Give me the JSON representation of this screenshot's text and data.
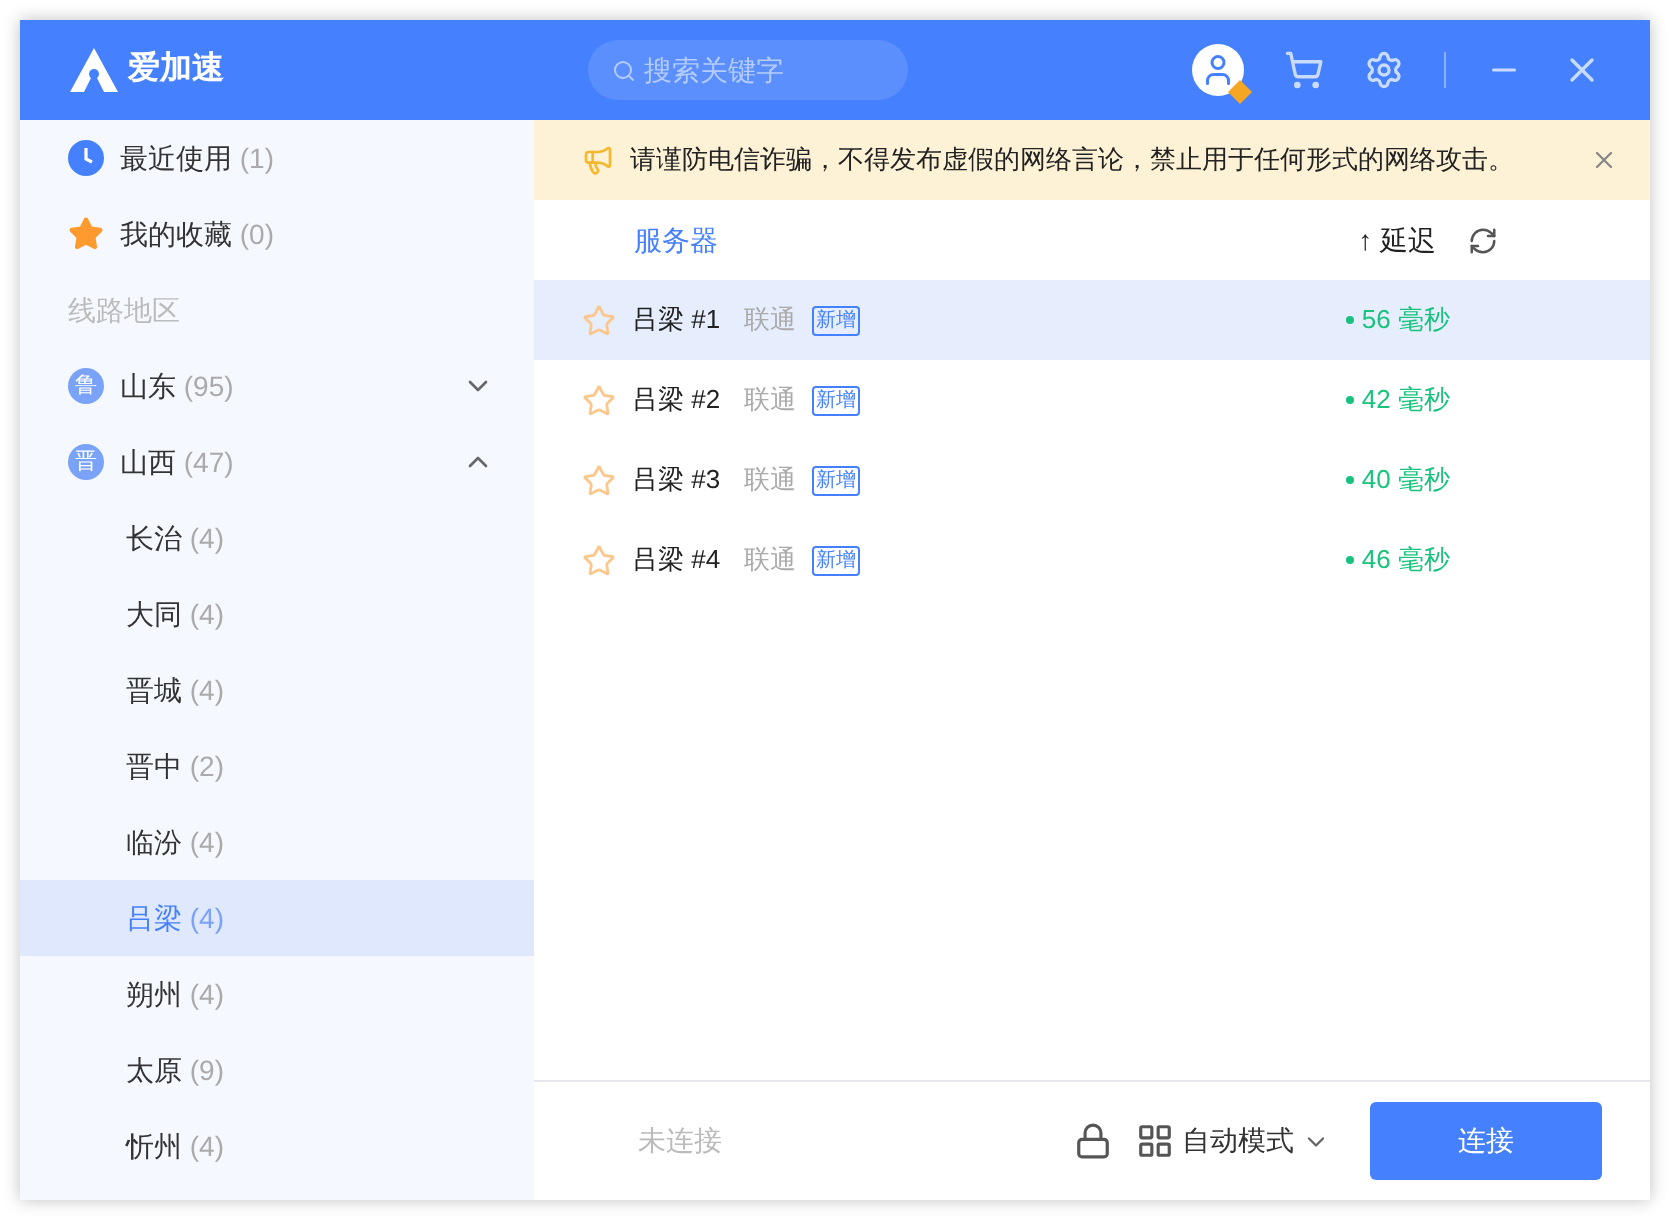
{
  "header": {
    "logo_text": "爱加速",
    "search": {
      "placeholder": "搜索关键字"
    }
  },
  "sidebar": {
    "quick": [
      {
        "kind": "recent",
        "label": "最近使用",
        "count": "(1)"
      },
      {
        "kind": "favorites",
        "label": "我的收藏",
        "count": "(0)"
      }
    ],
    "section_label": "线路地区",
    "regions": [
      {
        "badge": "鲁",
        "name": "山东",
        "count": "(95)",
        "expanded": false
      },
      {
        "badge": "晋",
        "name": "山西",
        "count": "(47)",
        "expanded": true,
        "children": [
          {
            "name": "长治",
            "count": "(4)",
            "selected": false
          },
          {
            "name": "大同",
            "count": "(4)",
            "selected": false
          },
          {
            "name": "晋城",
            "count": "(4)",
            "selected": false
          },
          {
            "name": "晋中",
            "count": "(2)",
            "selected": false
          },
          {
            "name": "临汾",
            "count": "(4)",
            "selected": false
          },
          {
            "name": "吕梁",
            "count": "(4)",
            "selected": true
          },
          {
            "name": "朔州",
            "count": "(4)",
            "selected": false
          },
          {
            "name": "太原",
            "count": "(9)",
            "selected": false
          },
          {
            "name": "忻州",
            "count": "(4)",
            "selected": false
          }
        ]
      }
    ]
  },
  "notice": {
    "text": "请谨防电信诈骗，不得发布虚假的网络言论，禁止用于任何形式的网络攻击。"
  },
  "list_header": {
    "server_column": "服务器",
    "sort_arrow": "↑",
    "latency_column": "延迟"
  },
  "servers": [
    {
      "name": "吕梁 #1",
      "isp": "联通",
      "tag": "新增",
      "latency": "56 毫秒",
      "selected": true,
      "favorite": false
    },
    {
      "name": "吕梁 #2",
      "isp": "联通",
      "tag": "新增",
      "latency": "42 毫秒",
      "selected": false,
      "favorite": false
    },
    {
      "name": "吕梁 #3",
      "isp": "联通",
      "tag": "新增",
      "latency": "40 毫秒",
      "selected": false,
      "favorite": false
    },
    {
      "name": "吕梁 #4",
      "isp": "联通",
      "tag": "新增",
      "latency": "46 毫秒",
      "selected": false,
      "favorite": false
    }
  ],
  "footer": {
    "status": "未连接",
    "mode": "自动模式",
    "connect_button": "连接"
  }
}
